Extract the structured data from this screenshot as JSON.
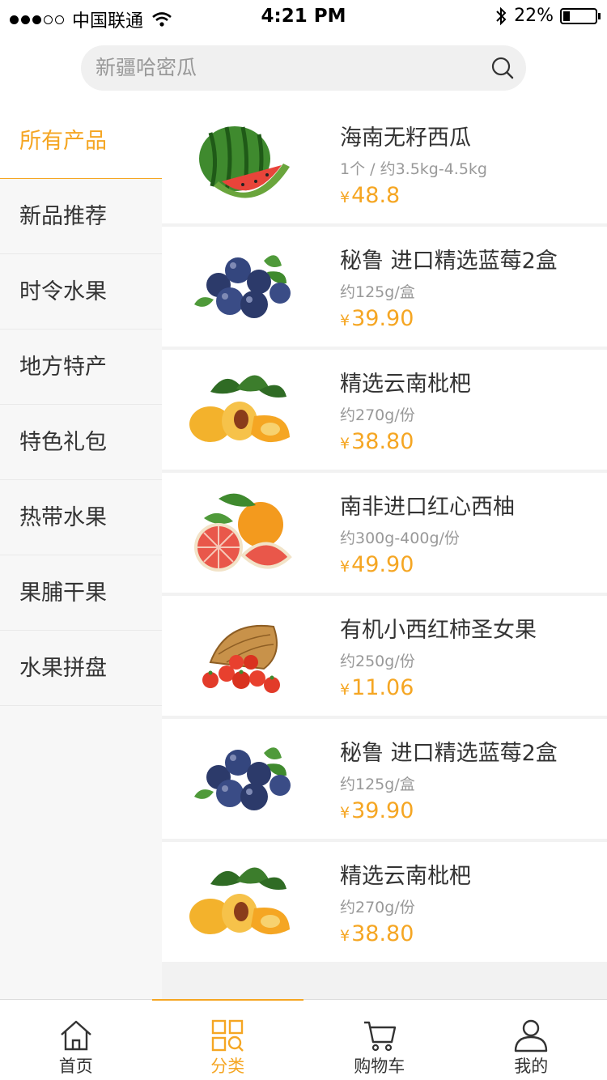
{
  "status_bar": {
    "carrier": "中国联通",
    "time": "4:21 PM",
    "battery": "22%",
    "battery_level": 0.22
  },
  "search": {
    "placeholder": "新疆哈密瓜",
    "icon": "search-icon"
  },
  "sidebar": {
    "items": [
      {
        "label": "所有产品",
        "active": true
      },
      {
        "label": "新品推荐"
      },
      {
        "label": "时令水果"
      },
      {
        "label": "地方特产"
      },
      {
        "label": "特色礼包"
      },
      {
        "label": "热带水果"
      },
      {
        "label": "果脯干果"
      },
      {
        "label": "水果拼盘"
      }
    ]
  },
  "products": [
    {
      "name": "海南无籽西瓜",
      "spec": "1个 / 约3.5kg-4.5kg",
      "currency": "¥",
      "price": "48.8",
      "image": "watermelon"
    },
    {
      "name": "秘鲁 进口精选蓝莓2盒",
      "spec": "约125g/盒",
      "currency": "¥",
      "price": "39.90",
      "image": "blueberry"
    },
    {
      "name": "精选云南枇杷",
      "spec": "约270g/份",
      "currency": "¥",
      "price": "38.80",
      "image": "loquat"
    },
    {
      "name": "南非进口红心西柚",
      "spec": "约300g-400g/份",
      "currency": "¥",
      "price": "49.90",
      "image": "grapefruit"
    },
    {
      "name": "有机小西红柿圣女果",
      "spec": "约250g/份",
      "currency": "¥",
      "price": "11.06",
      "image": "cherry-tomato"
    },
    {
      "name": "秘鲁 进口精选蓝莓2盒",
      "spec": "约125g/盒",
      "currency": "¥",
      "price": "39.90",
      "image": "blueberry"
    },
    {
      "name": "精选云南枇杷",
      "spec": "约270g/份",
      "currency": "¥",
      "price": "38.80",
      "image": "loquat"
    }
  ],
  "tab_bar": {
    "tabs": [
      {
        "label": "首页",
        "icon": "home-icon"
      },
      {
        "label": "分类",
        "icon": "category-icon",
        "active": true
      },
      {
        "label": "购物车",
        "icon": "cart-icon"
      },
      {
        "label": "我的",
        "icon": "user-icon"
      }
    ]
  },
  "colors": {
    "accent": "#f5a623",
    "sidebar_bg": "#f7f7f7",
    "text": "#333333",
    "muted": "#999999"
  }
}
